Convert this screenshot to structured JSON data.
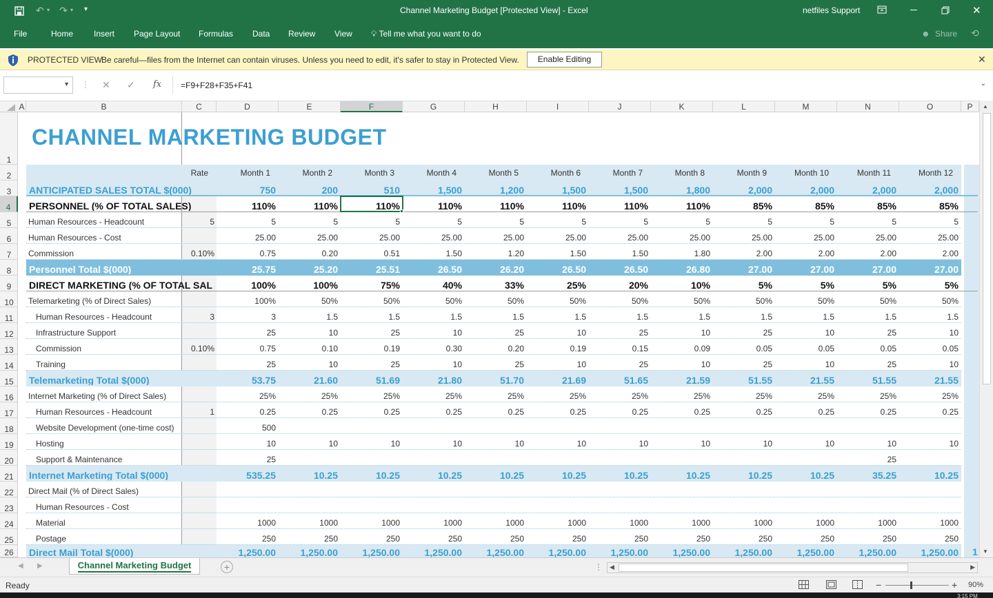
{
  "window": {
    "title": "Channel Marketing Budget  [Protected View]  -  Excel",
    "account": "netfiles Support"
  },
  "ribbon": {
    "tabs": [
      "File",
      "Home",
      "Insert",
      "Page Layout",
      "Formulas",
      "Data",
      "Review",
      "View"
    ],
    "tell_me": "Tell me what you want to do",
    "share": "Share"
  },
  "protected_view": {
    "label": "PROTECTED VIEW",
    "message": "Be careful—files from the Internet can contain viruses. Unless you need to edit, it's safer to stay in Protected View.",
    "button": "Enable Editing"
  },
  "formula_bar": {
    "name_box": "",
    "formula": "=F9+F28+F35+F41",
    "fx": "fx"
  },
  "columns": [
    "A",
    "B",
    "C",
    "D",
    "E",
    "F",
    "G",
    "H",
    "I",
    "J",
    "K",
    "L",
    "M",
    "N",
    "O",
    "P"
  ],
  "rows": [
    "1",
    "2",
    "3",
    "4",
    "5",
    "6",
    "7",
    "8",
    "9",
    "10",
    "11",
    "12",
    "13",
    "14",
    "15",
    "16",
    "17",
    "18",
    "19",
    "20",
    "21",
    "22",
    "23",
    "24",
    "25",
    "26"
  ],
  "sheet": {
    "title": "CHANNEL MARKETING BUDGET",
    "header": {
      "rate": "Rate",
      "months": [
        "Month 1",
        "Month 2",
        "Month 3",
        "Month 4",
        "Month 5",
        "Month 6",
        "Month 7",
        "Month 8",
        "Month 9",
        "Month 10",
        "Month 11",
        "Month 12"
      ]
    },
    "lines": [
      {
        "row": 3,
        "label": "ANTICIPATED SALES TOTAL $(000)",
        "rate": "",
        "vals": [
          "750",
          "200",
          "510",
          "1,500",
          "1,200",
          "1,500",
          "1,500",
          "1,800",
          "2,000",
          "2,000",
          "2,000",
          "2,000"
        ],
        "style": "sales"
      },
      {
        "row": 4,
        "label": "PERSONNEL (% OF TOTAL SALES)",
        "rate": "",
        "vals": [
          "110%",
          "110%",
          "110%",
          "110%",
          "110%",
          "110%",
          "110%",
          "110%",
          "85%",
          "85%",
          "85%",
          "85%"
        ],
        "style": "section"
      },
      {
        "row": 5,
        "label": "Human Resources - Headcount",
        "rate": "5",
        "vals": [
          "5",
          "5",
          "5",
          "5",
          "5",
          "5",
          "5",
          "5",
          "5",
          "5",
          "5",
          "5"
        ],
        "style": "item"
      },
      {
        "row": 6,
        "label": "Human Resources - Cost",
        "rate": "",
        "vals": [
          "25.00",
          "25.00",
          "25.00",
          "25.00",
          "25.00",
          "25.00",
          "25.00",
          "25.00",
          "25.00",
          "25.00",
          "25.00",
          "25.00"
        ],
        "style": "item"
      },
      {
        "row": 7,
        "label": "Commission",
        "rate": "0.10%",
        "vals": [
          "0.75",
          "0.20",
          "0.51",
          "1.50",
          "1.20",
          "1.50",
          "1.50",
          "1.80",
          "2.00",
          "2.00",
          "2.00",
          "2.00"
        ],
        "style": "item"
      },
      {
        "row": 8,
        "label": "Personnel Total $(000)",
        "rate": "",
        "vals": [
          "25.75",
          "25.20",
          "25.51",
          "26.50",
          "26.20",
          "26.50",
          "26.50",
          "26.80",
          "27.00",
          "27.00",
          "27.00",
          "27.00"
        ],
        "style": "darktotal"
      },
      {
        "row": 9,
        "label": "DIRECT MARKETING (% OF TOTAL SAL",
        "rate": "",
        "vals": [
          "100%",
          "100%",
          "75%",
          "40%",
          "33%",
          "25%",
          "20%",
          "10%",
          "5%",
          "5%",
          "5%",
          "5%"
        ],
        "style": "section"
      },
      {
        "row": 10,
        "label": "Telemarketing (% of Direct Sales)",
        "rate": "",
        "vals": [
          "100%",
          "50%",
          "50%",
          "50%",
          "50%",
          "50%",
          "50%",
          "50%",
          "50%",
          "50%",
          "50%",
          "50%"
        ],
        "style": "item"
      },
      {
        "row": 11,
        "label": "Human Resources - Headcount",
        "rate": "3",
        "vals": [
          "3",
          "1.5",
          "1.5",
          "1.5",
          "1.5",
          "1.5",
          "1.5",
          "1.5",
          "1.5",
          "1.5",
          "1.5",
          "1.5"
        ],
        "style": "sub"
      },
      {
        "row": 12,
        "label": "Infrastructure Support",
        "rate": "",
        "vals": [
          "25",
          "10",
          "25",
          "10",
          "25",
          "10",
          "25",
          "10",
          "25",
          "10",
          "25",
          "10"
        ],
        "style": "sub"
      },
      {
        "row": 13,
        "label": "Commission",
        "rate": "0.10%",
        "vals": [
          "0.75",
          "0.10",
          "0.19",
          "0.30",
          "0.20",
          "0.19",
          "0.15",
          "0.09",
          "0.05",
          "0.05",
          "0.05",
          "0.05"
        ],
        "style": "sub"
      },
      {
        "row": 14,
        "label": "Training",
        "rate": "",
        "vals": [
          "25",
          "10",
          "25",
          "10",
          "25",
          "10",
          "25",
          "10",
          "25",
          "10",
          "25",
          "10"
        ],
        "style": "sub"
      },
      {
        "row": 15,
        "label": "Telemarketing Total $(000)",
        "rate": "",
        "vals": [
          "53.75",
          "21.60",
          "51.69",
          "21.80",
          "51.70",
          "21.69",
          "51.65",
          "21.59",
          "51.55",
          "21.55",
          "51.55",
          "21.55"
        ],
        "style": "lighttotal"
      },
      {
        "row": 16,
        "label": "Internet Marketing (% of Direct Sales)",
        "rate": "",
        "vals": [
          "25%",
          "25%",
          "25%",
          "25%",
          "25%",
          "25%",
          "25%",
          "25%",
          "25%",
          "25%",
          "25%",
          "25%"
        ],
        "style": "item"
      },
      {
        "row": 17,
        "label": "Human Resources - Headcount",
        "rate": "1",
        "vals": [
          "0.25",
          "0.25",
          "0.25",
          "0.25",
          "0.25",
          "0.25",
          "0.25",
          "0.25",
          "0.25",
          "0.25",
          "0.25",
          "0.25"
        ],
        "style": "sub"
      },
      {
        "row": 18,
        "label": "Website Development (one-time cost)",
        "rate": "",
        "vals": [
          "500",
          "",
          "",
          "",
          "",
          "",
          "",
          "",
          "",
          "",
          "",
          ""
        ],
        "style": "sub"
      },
      {
        "row": 19,
        "label": "Hosting",
        "rate": "",
        "vals": [
          "10",
          "10",
          "10",
          "10",
          "10",
          "10",
          "10",
          "10",
          "10",
          "10",
          "10",
          "10"
        ],
        "style": "sub"
      },
      {
        "row": 20,
        "label": "Support & Maintenance",
        "rate": "",
        "vals": [
          "25",
          "",
          "",
          "",
          "",
          "",
          "",
          "",
          "",
          "",
          "25",
          ""
        ],
        "style": "sub"
      },
      {
        "row": 21,
        "label": "Internet Marketing Total $(000)",
        "rate": "",
        "vals": [
          "535.25",
          "10.25",
          "10.25",
          "10.25",
          "10.25",
          "10.25",
          "10.25",
          "10.25",
          "10.25",
          "10.25",
          "35.25",
          "10.25"
        ],
        "style": "lighttotal"
      },
      {
        "row": 22,
        "label": "Direct Mail (% of Direct Sales)",
        "rate": "",
        "vals": [
          "",
          "",
          "",
          "",
          "",
          "",
          "",
          "",
          "",
          "",
          "",
          ""
        ],
        "style": "item"
      },
      {
        "row": 23,
        "label": "Human Resources - Cost",
        "rate": "",
        "vals": [
          "",
          "",
          "",
          "",
          "",
          "",
          "",
          "",
          "",
          "",
          "",
          ""
        ],
        "style": "sub"
      },
      {
        "row": 24,
        "label": "Material",
        "rate": "",
        "vals": [
          "1000",
          "1000",
          "1000",
          "1000",
          "1000",
          "1000",
          "1000",
          "1000",
          "1000",
          "1000",
          "1000",
          "1000"
        ],
        "style": "sub"
      },
      {
        "row": 25,
        "label": "Postage",
        "rate": "",
        "vals": [
          "250",
          "250",
          "250",
          "250",
          "250",
          "250",
          "250",
          "250",
          "250",
          "250",
          "250",
          "250"
        ],
        "style": "sub"
      },
      {
        "row": 26,
        "label": "Direct Mail Total $(000)",
        "rate": "",
        "vals": [
          "1,250.00",
          "1,250.00",
          "1,250.00",
          "1,250.00",
          "1,250.00",
          "1,250.00",
          "1,250.00",
          "1,250.00",
          "1,250.00",
          "1,250.00",
          "1,250.00",
          "1,250.00"
        ],
        "style": "lighttotal"
      }
    ],
    "p26_partial": "1"
  },
  "sheet_tab": "Channel Marketing Budget",
  "status": {
    "ready": "Ready",
    "zoom": "90%",
    "time": "3:15 PM"
  },
  "colors": {
    "excel_green": "#217346",
    "title_blue": "#3d9fd0",
    "band_light": "#d8e9f3",
    "band_dark": "#7fbfdd",
    "protected_yellow": "#fdf6c3"
  }
}
